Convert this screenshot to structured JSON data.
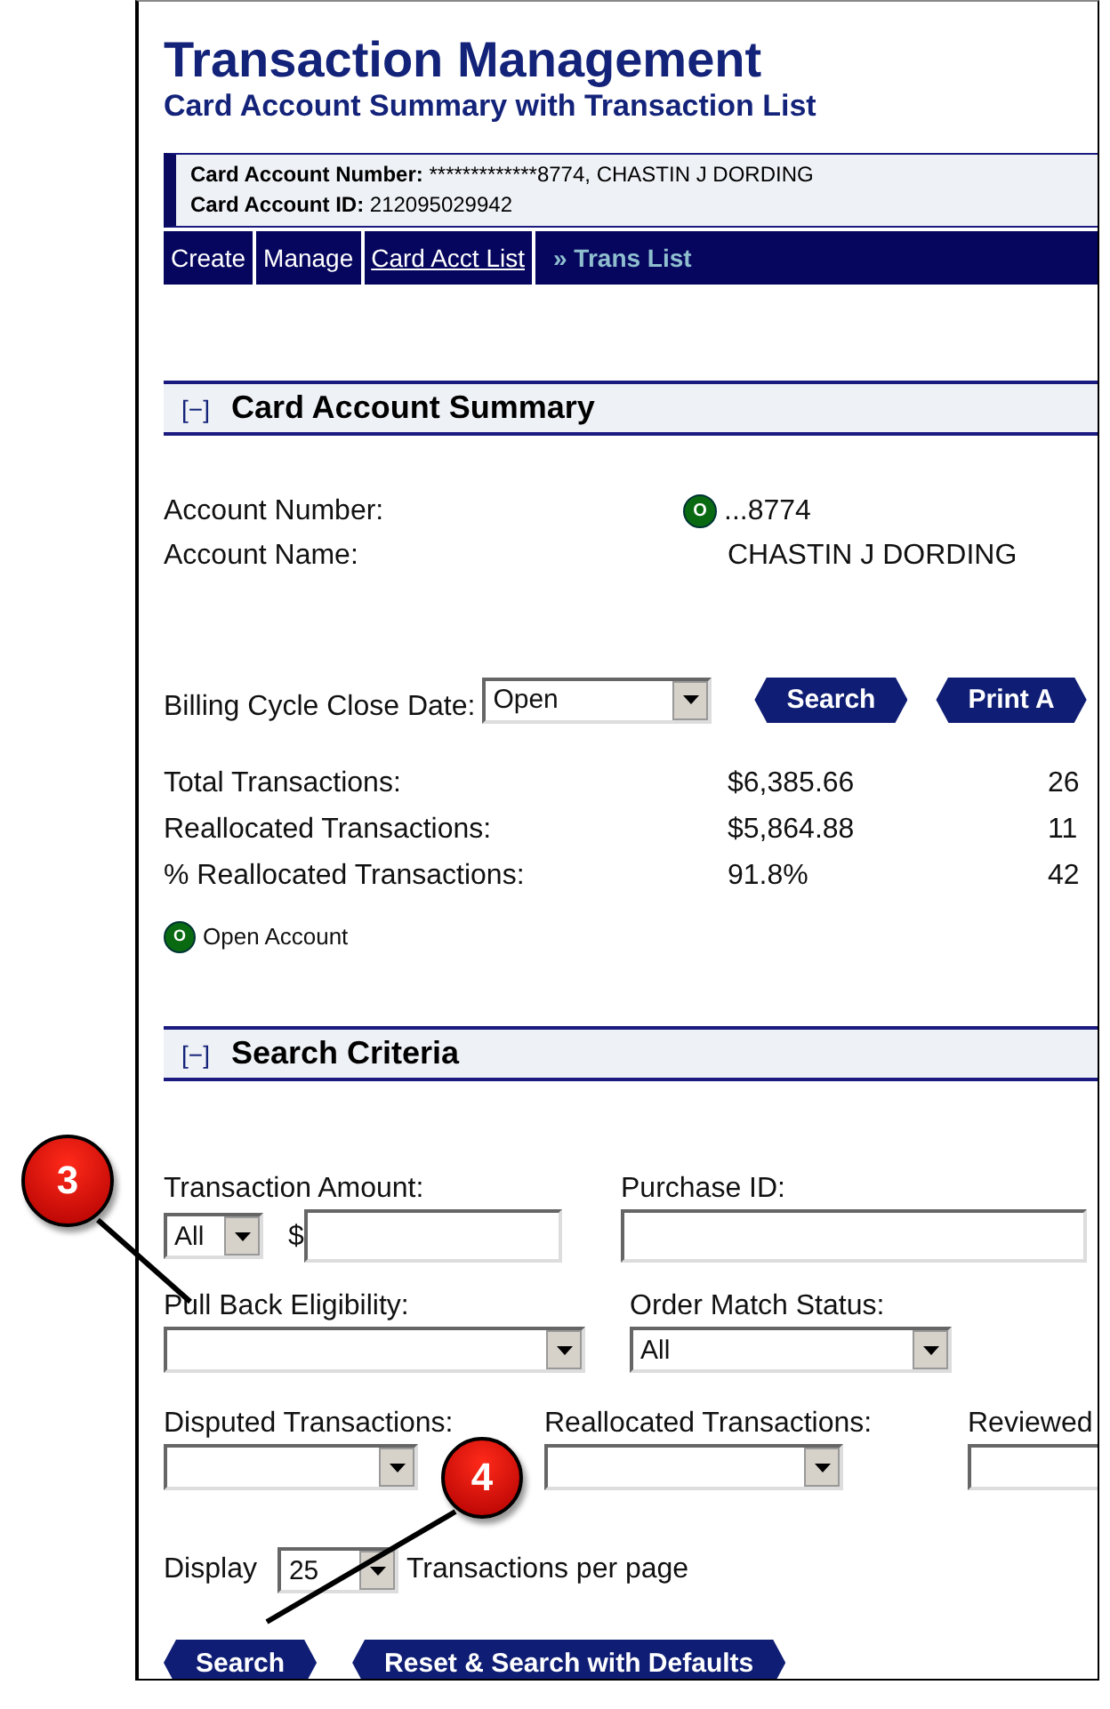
{
  "header": {
    "title": "Transaction Management",
    "subtitle": "Card Account Summary with Transaction List"
  },
  "account_info": [
    {
      "label": "Card Account Number:",
      "value": "*************8774, CHASTIN J DORDING"
    },
    {
      "label": "Card Account ID:",
      "value": "212095029942"
    }
  ],
  "nav": [
    {
      "label": "Create",
      "kind": "plain"
    },
    {
      "label": "Manage",
      "kind": "plain"
    },
    {
      "label": "Card Acct List",
      "kind": "link"
    },
    {
      "label": "» Trans List",
      "kind": "current"
    }
  ],
  "summary": {
    "toggle": "[−]",
    "title": "Card Account Summary",
    "account_number_label": "Account Number:",
    "status_letter": "O",
    "account_number": "...8774",
    "account_name_label": "Account Name:",
    "account_name": "CHASTIN J DORDING",
    "billing_label": "Billing Cycle Close Date:",
    "billing_value": "Open",
    "buttons": [
      "Search",
      "Print A"
    ],
    "totals": [
      {
        "label": "Total Transactions:",
        "amount": "$6,385.66",
        "count": "26"
      },
      {
        "label": "Reallocated Transactions:",
        "amount": "$5,864.88",
        "count": "11"
      },
      {
        "label": "% Reallocated Transactions:",
        "amount": "91.8%",
        "count": "42"
      }
    ],
    "legend": {
      "letter": "O",
      "text": "Open Account"
    }
  },
  "search": {
    "toggle": "[−]",
    "title": "Search Criteria",
    "amount_label": "Transaction Amount:",
    "amount_op": "All",
    "currency": "$",
    "purchase_label": "Purchase ID:",
    "pullback_label": "Pull Back Eligibility:",
    "order_match_label": "Order Match Status:",
    "order_match_value": "All",
    "disputed_label": "Disputed Transactions:",
    "reallocated_label": "Reallocated Transactions:",
    "reviewed_label": "Reviewed",
    "display_label": "Display",
    "display_value": "25",
    "per_page_label": "Transactions per page",
    "buttons": [
      "Search",
      "Reset & Search with Defaults"
    ]
  },
  "callouts": [
    "3",
    "4"
  ]
}
